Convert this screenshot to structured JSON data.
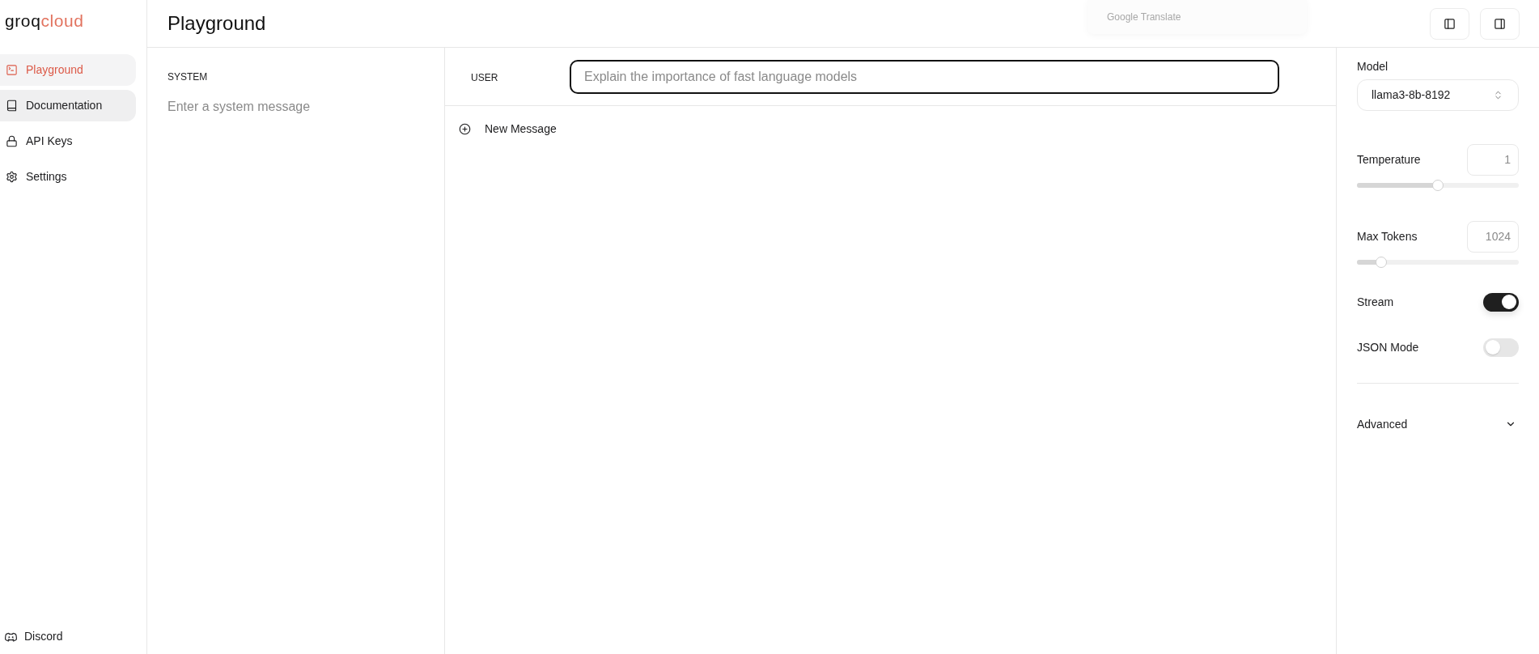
{
  "sidebar": {
    "logo": {
      "part_1": "groq",
      "part_2": "cloud"
    },
    "items": [
      {
        "label": "Playground",
        "selected": true,
        "hovered": false
      },
      {
        "label": "Documentation",
        "selected": false,
        "hovered": true
      },
      {
        "label": "API Keys",
        "selected": false,
        "hovered": false
      },
      {
        "label": "Settings",
        "selected": false,
        "hovered": false
      }
    ],
    "footer_link": {
      "label": "Discord"
    }
  },
  "header": {
    "title": "Playground",
    "translate_popup": {
      "text": "Google Translate"
    }
  },
  "system": {
    "label": "SYSTEM",
    "placeholder": "Enter a system message"
  },
  "messages": [
    {
      "role": "USER",
      "placeholder": "Explain the importance of fast language models",
      "focused": true
    }
  ],
  "new_message": {
    "label": "New Message"
  },
  "settings": {
    "model": {
      "label": "Model",
      "value": "llama3-8b-8192"
    },
    "sliders": [
      {
        "label": "Temperature",
        "value": "1",
        "level": 0.5
      },
      {
        "label": "Max Tokens",
        "value": "1024",
        "level": 0.125
      }
    ],
    "toggles": [
      {
        "label": "Stream",
        "on": true
      },
      {
        "label": "JSON Mode",
        "on": false
      }
    ],
    "advanced": {
      "label": "Advanced",
      "expanded": false
    }
  }
}
